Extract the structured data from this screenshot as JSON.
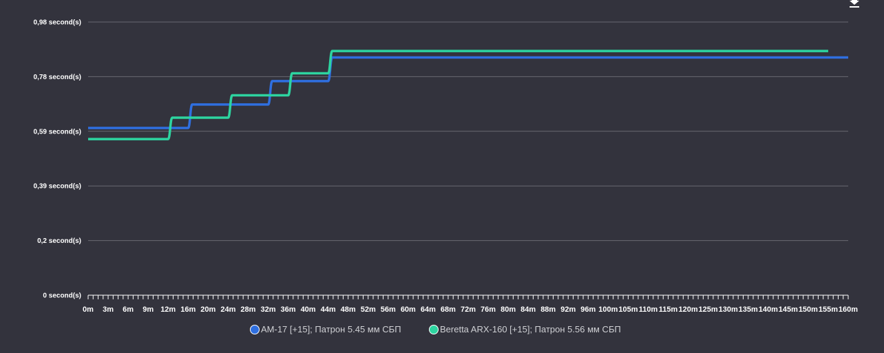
{
  "toolbar": {
    "download_icon": "download-icon"
  },
  "chart_data": {
    "type": "line",
    "title": "",
    "xlabel": "",
    "ylabel": "",
    "ylim": [
      0,
      0.98
    ],
    "y_ticks": [
      {
        "value": 0,
        "label": "0 second(s)"
      },
      {
        "value": 0.196,
        "label": "0,2 second(s)"
      },
      {
        "value": 0.392,
        "label": "0,39 second(s)"
      },
      {
        "value": 0.588,
        "label": "0,59 second(s)"
      },
      {
        "value": 0.784,
        "label": "0,78 second(s)"
      },
      {
        "value": 0.98,
        "label": "0,98 second(s)"
      }
    ],
    "x_tick_labels": [
      "0m",
      "3m",
      "6m",
      "9m",
      "12m",
      "16m",
      "20m",
      "24m",
      "28m",
      "32m",
      "36m",
      "40m",
      "44m",
      "48m",
      "52m",
      "56m",
      "60m",
      "64m",
      "68m",
      "72m",
      "76m",
      "80m",
      "84m",
      "88m",
      "92m",
      "96m",
      "100m",
      "105m",
      "110m",
      "115m",
      "120m",
      "125m",
      "130m",
      "135m",
      "140m",
      "145m",
      "150m",
      "155m",
      "160m"
    ],
    "grid": true,
    "legend_position": "bottom",
    "series": [
      {
        "name": "AM-17 [+15]; Патрон 5.45 мм СБП",
        "color": "#2f6fe0",
        "steps": [
          {
            "x": "0m",
            "y": 0.6
          },
          {
            "x": "16m",
            "y": 0.684
          },
          {
            "x": "32m",
            "y": 0.768
          },
          {
            "x": "44m",
            "y": 0.853
          },
          {
            "x": "160m",
            "y": 0.853
          }
        ]
      },
      {
        "name": "Beretta ARX-160 [+15]; Патрон 5.56 мм СБП",
        "color": "#2dd4a0",
        "steps": [
          {
            "x": "0m",
            "y": 0.56
          },
          {
            "x": "12m",
            "y": 0.637
          },
          {
            "x": "24m",
            "y": 0.717
          },
          {
            "x": "36m",
            "y": 0.796
          },
          {
            "x": "44m",
            "y": 0.876
          },
          {
            "x": "155m",
            "y": 0.876
          }
        ]
      }
    ]
  }
}
